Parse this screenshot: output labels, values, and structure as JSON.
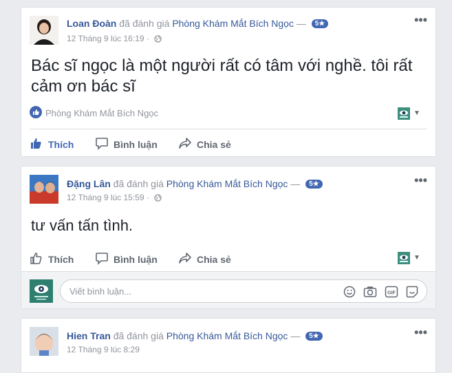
{
  "posts": [
    {
      "author": "Loan Đoàn",
      "verb": "đã đánh giá",
      "page_name": "Phòng Khám Mắt Bích Ngọc",
      "dash": "—",
      "rating_badge": "5★",
      "timestamp": "12 Tháng 9 lúc 16:19",
      "separator": "·",
      "text": "Bác sĩ ngọc là một người rất có tâm với nghề. tôi rất cảm ơn bác sĩ",
      "liked_by": "Phòng Khám Mắt Bích Ngọc",
      "like_label": "Thích",
      "comment_label": "Bình luận",
      "share_label": "Chia sẻ"
    },
    {
      "author": "Đặng Lân",
      "verb": "đã đánh giá",
      "page_name": "Phòng Khám Mắt Bích Ngọc",
      "dash": "—",
      "rating_badge": "5★",
      "timestamp": "12 Tháng 9 lúc 15:59",
      "separator": "·",
      "text": "tư vấn tấn tình.",
      "like_label": "Thích",
      "comment_label": "Bình luận",
      "share_label": "Chia sẻ",
      "comment_placeholder": "Viết bình luận..."
    },
    {
      "author": "Hien Tran",
      "verb": "đã đánh giá",
      "page_name": "Phòng Khám Mắt Bích Ngọc",
      "dash": "—",
      "rating_badge": "5★",
      "timestamp": "12 Tháng 9 lúc 8:29"
    }
  ],
  "colors": {
    "link": "#365899",
    "accent": "#4267b2",
    "muted": "#90949c",
    "background": "#e9ebee"
  }
}
